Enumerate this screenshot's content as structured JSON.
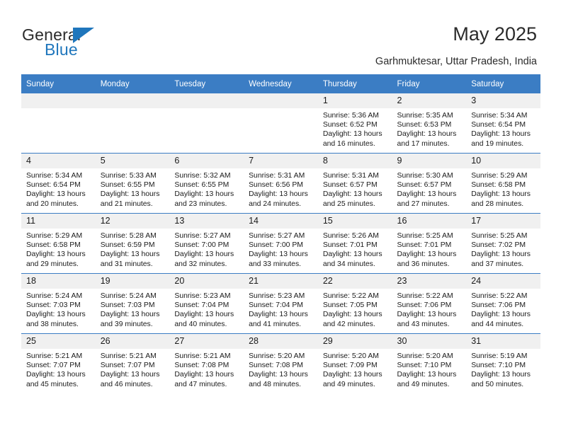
{
  "brand": {
    "name_part1": "General",
    "name_part2": "Blue",
    "flag_icon": "blue-triangle-flag"
  },
  "header": {
    "title": "May 2025",
    "location": "Garhmuktesar, Uttar Pradesh, India"
  },
  "colors": {
    "header_blue": "#3b7dc4",
    "brand_blue": "#1f76bc",
    "daynum_band": "#f0f0f0",
    "text": "#1a1a1a"
  },
  "weekday_headers": [
    "Sunday",
    "Monday",
    "Tuesday",
    "Wednesday",
    "Thursday",
    "Friday",
    "Saturday"
  ],
  "labels": {
    "sunrise": "Sunrise:",
    "sunset": "Sunset:",
    "daylight": "Daylight:"
  },
  "weeks": [
    [
      {
        "day": "",
        "empty": true
      },
      {
        "day": "",
        "empty": true
      },
      {
        "day": "",
        "empty": true
      },
      {
        "day": "",
        "empty": true
      },
      {
        "day": "1",
        "sunrise": "Sunrise: 5:36 AM",
        "sunset": "Sunset: 6:52 PM",
        "daylight": "Daylight: 13 hours and 16 minutes."
      },
      {
        "day": "2",
        "sunrise": "Sunrise: 5:35 AM",
        "sunset": "Sunset: 6:53 PM",
        "daylight": "Daylight: 13 hours and 17 minutes."
      },
      {
        "day": "3",
        "sunrise": "Sunrise: 5:34 AM",
        "sunset": "Sunset: 6:54 PM",
        "daylight": "Daylight: 13 hours and 19 minutes."
      }
    ],
    [
      {
        "day": "4",
        "sunrise": "Sunrise: 5:34 AM",
        "sunset": "Sunset: 6:54 PM",
        "daylight": "Daylight: 13 hours and 20 minutes."
      },
      {
        "day": "5",
        "sunrise": "Sunrise: 5:33 AM",
        "sunset": "Sunset: 6:55 PM",
        "daylight": "Daylight: 13 hours and 21 minutes."
      },
      {
        "day": "6",
        "sunrise": "Sunrise: 5:32 AM",
        "sunset": "Sunset: 6:55 PM",
        "daylight": "Daylight: 13 hours and 23 minutes."
      },
      {
        "day": "7",
        "sunrise": "Sunrise: 5:31 AM",
        "sunset": "Sunset: 6:56 PM",
        "daylight": "Daylight: 13 hours and 24 minutes."
      },
      {
        "day": "8",
        "sunrise": "Sunrise: 5:31 AM",
        "sunset": "Sunset: 6:57 PM",
        "daylight": "Daylight: 13 hours and 25 minutes."
      },
      {
        "day": "9",
        "sunrise": "Sunrise: 5:30 AM",
        "sunset": "Sunset: 6:57 PM",
        "daylight": "Daylight: 13 hours and 27 minutes."
      },
      {
        "day": "10",
        "sunrise": "Sunrise: 5:29 AM",
        "sunset": "Sunset: 6:58 PM",
        "daylight": "Daylight: 13 hours and 28 minutes."
      }
    ],
    [
      {
        "day": "11",
        "sunrise": "Sunrise: 5:29 AM",
        "sunset": "Sunset: 6:58 PM",
        "daylight": "Daylight: 13 hours and 29 minutes."
      },
      {
        "day": "12",
        "sunrise": "Sunrise: 5:28 AM",
        "sunset": "Sunset: 6:59 PM",
        "daylight": "Daylight: 13 hours and 31 minutes."
      },
      {
        "day": "13",
        "sunrise": "Sunrise: 5:27 AM",
        "sunset": "Sunset: 7:00 PM",
        "daylight": "Daylight: 13 hours and 32 minutes."
      },
      {
        "day": "14",
        "sunrise": "Sunrise: 5:27 AM",
        "sunset": "Sunset: 7:00 PM",
        "daylight": "Daylight: 13 hours and 33 minutes."
      },
      {
        "day": "15",
        "sunrise": "Sunrise: 5:26 AM",
        "sunset": "Sunset: 7:01 PM",
        "daylight": "Daylight: 13 hours and 34 minutes."
      },
      {
        "day": "16",
        "sunrise": "Sunrise: 5:25 AM",
        "sunset": "Sunset: 7:01 PM",
        "daylight": "Daylight: 13 hours and 36 minutes."
      },
      {
        "day": "17",
        "sunrise": "Sunrise: 5:25 AM",
        "sunset": "Sunset: 7:02 PM",
        "daylight": "Daylight: 13 hours and 37 minutes."
      }
    ],
    [
      {
        "day": "18",
        "sunrise": "Sunrise: 5:24 AM",
        "sunset": "Sunset: 7:03 PM",
        "daylight": "Daylight: 13 hours and 38 minutes."
      },
      {
        "day": "19",
        "sunrise": "Sunrise: 5:24 AM",
        "sunset": "Sunset: 7:03 PM",
        "daylight": "Daylight: 13 hours and 39 minutes."
      },
      {
        "day": "20",
        "sunrise": "Sunrise: 5:23 AM",
        "sunset": "Sunset: 7:04 PM",
        "daylight": "Daylight: 13 hours and 40 minutes."
      },
      {
        "day": "21",
        "sunrise": "Sunrise: 5:23 AM",
        "sunset": "Sunset: 7:04 PM",
        "daylight": "Daylight: 13 hours and 41 minutes."
      },
      {
        "day": "22",
        "sunrise": "Sunrise: 5:22 AM",
        "sunset": "Sunset: 7:05 PM",
        "daylight": "Daylight: 13 hours and 42 minutes."
      },
      {
        "day": "23",
        "sunrise": "Sunrise: 5:22 AM",
        "sunset": "Sunset: 7:06 PM",
        "daylight": "Daylight: 13 hours and 43 minutes."
      },
      {
        "day": "24",
        "sunrise": "Sunrise: 5:22 AM",
        "sunset": "Sunset: 7:06 PM",
        "daylight": "Daylight: 13 hours and 44 minutes."
      }
    ],
    [
      {
        "day": "25",
        "sunrise": "Sunrise: 5:21 AM",
        "sunset": "Sunset: 7:07 PM",
        "daylight": "Daylight: 13 hours and 45 minutes."
      },
      {
        "day": "26",
        "sunrise": "Sunrise: 5:21 AM",
        "sunset": "Sunset: 7:07 PM",
        "daylight": "Daylight: 13 hours and 46 minutes."
      },
      {
        "day": "27",
        "sunrise": "Sunrise: 5:21 AM",
        "sunset": "Sunset: 7:08 PM",
        "daylight": "Daylight: 13 hours and 47 minutes."
      },
      {
        "day": "28",
        "sunrise": "Sunrise: 5:20 AM",
        "sunset": "Sunset: 7:08 PM",
        "daylight": "Daylight: 13 hours and 48 minutes."
      },
      {
        "day": "29",
        "sunrise": "Sunrise: 5:20 AM",
        "sunset": "Sunset: 7:09 PM",
        "daylight": "Daylight: 13 hours and 49 minutes."
      },
      {
        "day": "30",
        "sunrise": "Sunrise: 5:20 AM",
        "sunset": "Sunset: 7:10 PM",
        "daylight": "Daylight: 13 hours and 49 minutes."
      },
      {
        "day": "31",
        "sunrise": "Sunrise: 5:19 AM",
        "sunset": "Sunset: 7:10 PM",
        "daylight": "Daylight: 13 hours and 50 minutes."
      }
    ]
  ]
}
